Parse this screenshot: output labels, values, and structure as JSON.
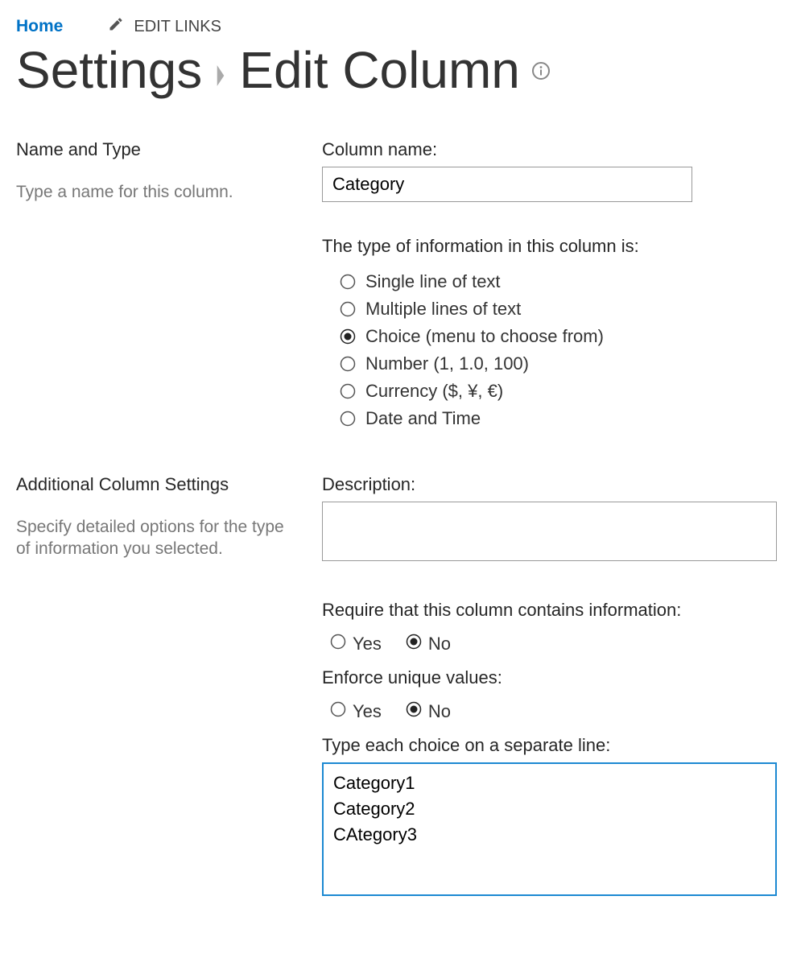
{
  "topnav": {
    "home": "Home",
    "edit_links": "EDIT LINKS"
  },
  "breadcrumb": {
    "settings": "Settings",
    "edit_column": "Edit Column"
  },
  "sections": {
    "name_type": {
      "title": "Name and Type",
      "desc": "Type a name for this column."
    },
    "additional": {
      "title": "Additional Column Settings",
      "desc": "Specify detailed options for the type of information you selected."
    }
  },
  "fields": {
    "column_name_label": "Column name:",
    "column_name_value": "Category",
    "type_label": "The type of information in this column is:",
    "type_options": {
      "o0": "Single line of text",
      "o1": "Multiple lines of text",
      "o2": "Choice (menu to choose from)",
      "o3": "Number (1, 1.0, 100)",
      "o4": "Currency ($, ¥, €)",
      "o5": "Date and Time"
    },
    "description_label": "Description:",
    "description_value": "",
    "require_label": "Require that this column contains information:",
    "unique_label": "Enforce unique values:",
    "choices_label": "Type each choice on a separate line:",
    "choices_value": "Category1\nCategory2\nCAtegory3",
    "yes": "Yes",
    "no": "No"
  }
}
